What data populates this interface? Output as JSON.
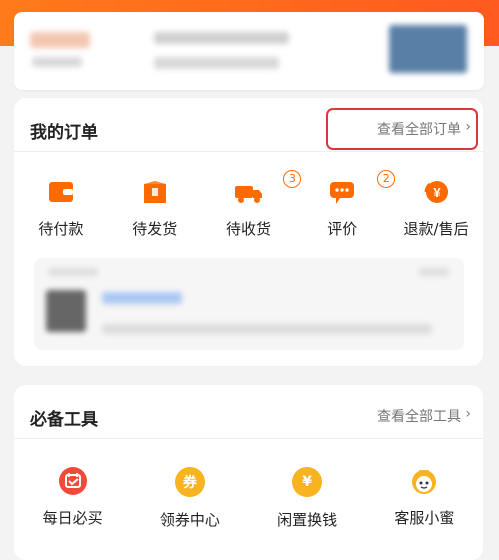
{
  "orders": {
    "title": "我的订单",
    "see_all": "查看全部订单",
    "items": [
      {
        "label": "待付款",
        "icon": "wallet-icon",
        "badge": ""
      },
      {
        "label": "待发货",
        "icon": "package-icon",
        "badge": ""
      },
      {
        "label": "待收货",
        "icon": "truck-icon",
        "badge": "3"
      },
      {
        "label": "评价",
        "icon": "comment-icon",
        "badge": "2"
      },
      {
        "label": "退款/售后",
        "icon": "refund-icon",
        "badge": ""
      }
    ]
  },
  "tools": {
    "title": "必备工具",
    "see_all": "查看全部工具",
    "items": [
      {
        "label": "每日必买",
        "icon": "calendar-icon"
      },
      {
        "label": "领券中心",
        "icon": "coupon-icon"
      },
      {
        "label": "闲置换钱",
        "icon": "yen-icon"
      },
      {
        "label": "客服小蜜",
        "icon": "bee-icon"
      }
    ],
    "coupon_glyph": "券",
    "yen_glyph": "¥"
  },
  "colors": {
    "accent_orange": "#ff6a00",
    "highlight_red": "#d9363e",
    "tool_red": "#f04a3a",
    "tool_gold": "#f7b320"
  }
}
